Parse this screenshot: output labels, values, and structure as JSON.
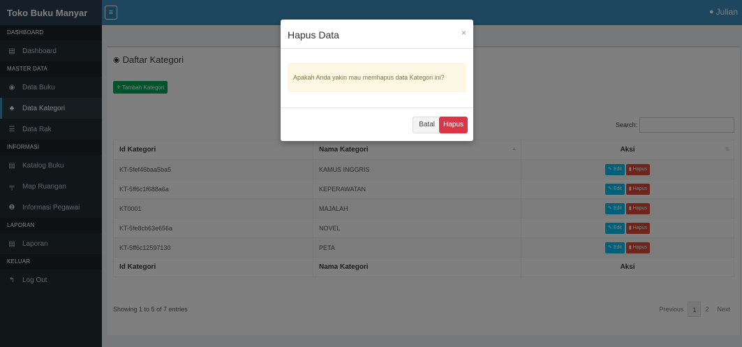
{
  "brand": "Toko Buku Manyar",
  "user": "Julian",
  "sidebar": {
    "sections": [
      {
        "title": "DASHBOARD",
        "items": [
          {
            "label": "Dashboard",
            "icon": "dashboard-icon"
          }
        ]
      },
      {
        "title": "MASTER DATA",
        "items": [
          {
            "label": "Data Buku",
            "icon": "book-icon"
          },
          {
            "label": "Data Kategori",
            "icon": "category-icon"
          },
          {
            "label": "Data Rak",
            "icon": "shelf-icon"
          }
        ]
      },
      {
        "title": "INFORMASI",
        "items": [
          {
            "label": "Katalog Buku",
            "icon": "catalog-icon"
          },
          {
            "label": "Map Ruangan",
            "icon": "map-icon"
          },
          {
            "label": "Informasi Pegawai",
            "icon": "info-icon"
          }
        ]
      },
      {
        "title": "LAPORAN",
        "items": [
          {
            "label": "Laporan",
            "icon": "report-icon"
          }
        ]
      },
      {
        "title": "KELUAR",
        "items": [
          {
            "label": "Log Out",
            "icon": "logout-icon"
          }
        ]
      }
    ],
    "active": "Data Kategori"
  },
  "main": {
    "title": "Daftar Kategori",
    "add_button": "Tambah Kategori",
    "search_label": "Search:",
    "search_value": "",
    "columns": [
      "Id Kategori",
      "Nama Kategori",
      "Aksi"
    ],
    "rows": [
      {
        "id": "KT-5fef46baa5ba5",
        "name": "KAMUS INGGRIS"
      },
      {
        "id": "KT-5ff6c1f688a6a",
        "name": "KEPERAWATAN"
      },
      {
        "id": "KT0001",
        "name": "MAJALAH"
      },
      {
        "id": "KT-5fe8cb63e656a",
        "name": "NOVEL"
      },
      {
        "id": "KT-5ff6c12597130",
        "name": "PETA"
      }
    ],
    "edit_label": "Edit",
    "delete_label": "Hapus",
    "info": "Showing 1 to 5 of 7 entries",
    "pagination": {
      "previous": "Previous",
      "pages": [
        "1",
        "2"
      ],
      "next": "Next"
    }
  },
  "modal": {
    "title": "Hapus Data",
    "close": "×",
    "message": "Apakah Anda yakin mau memhapus data Kategori ini?",
    "cancel": "Batal",
    "confirm": "Hapus"
  },
  "colors": {
    "navbar": "#3c8dbc",
    "sidebar": "#222d32",
    "add": "#00a65a",
    "edit": "#00c0ef",
    "delete": "#dd4b39",
    "confirm": "#dc3545"
  }
}
